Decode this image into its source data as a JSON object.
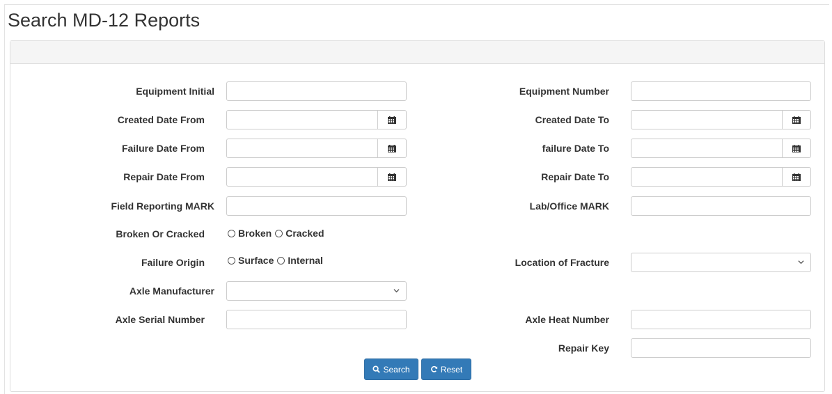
{
  "page": {
    "title": "Search MD-12 Reports"
  },
  "fields": {
    "equipment_initial": {
      "label": "Equipment Initial",
      "value": ""
    },
    "equipment_number": {
      "label": "Equipment Number",
      "value": ""
    },
    "created_date_from": {
      "label": "Created Date From",
      "value": ""
    },
    "created_date_to": {
      "label": "Created Date To",
      "value": ""
    },
    "failure_date_from": {
      "label": "Failure Date From",
      "value": ""
    },
    "failure_date_to": {
      "label": "failure Date To",
      "value": ""
    },
    "repair_date_from": {
      "label": "Repair Date From",
      "value": ""
    },
    "repair_date_to": {
      "label": "Repair Date To",
      "value": ""
    },
    "field_reporting_mark": {
      "label": "Field Reporting MARK",
      "value": ""
    },
    "lab_office_mark": {
      "label": "Lab/Office MARK",
      "value": ""
    },
    "broken_or_cracked": {
      "label": "Broken Or Cracked",
      "options": [
        "Broken",
        "Cracked"
      ]
    },
    "failure_origin": {
      "label": "Failure Origin",
      "options": [
        "Surface",
        "Internal"
      ]
    },
    "location_of_fracture": {
      "label": "Location of Fracture",
      "selected": ""
    },
    "axle_manufacturer": {
      "label": "Axle Manufacturer",
      "selected": ""
    },
    "axle_serial_number": {
      "label": "Axle Serial Number",
      "value": ""
    },
    "axle_heat_number": {
      "label": "Axle Heat Number",
      "value": ""
    },
    "repair_key": {
      "label": "Repair Key",
      "value": ""
    }
  },
  "buttons": {
    "search": "Search",
    "reset": "Reset"
  },
  "icons": {
    "calendar": "calendar-icon",
    "search": "search-icon",
    "reset": "refresh-icon",
    "dropdown": "chevron-down-icon"
  },
  "colors": {
    "primary": "#337ab7",
    "panel_heading": "#f5f5f5"
  }
}
